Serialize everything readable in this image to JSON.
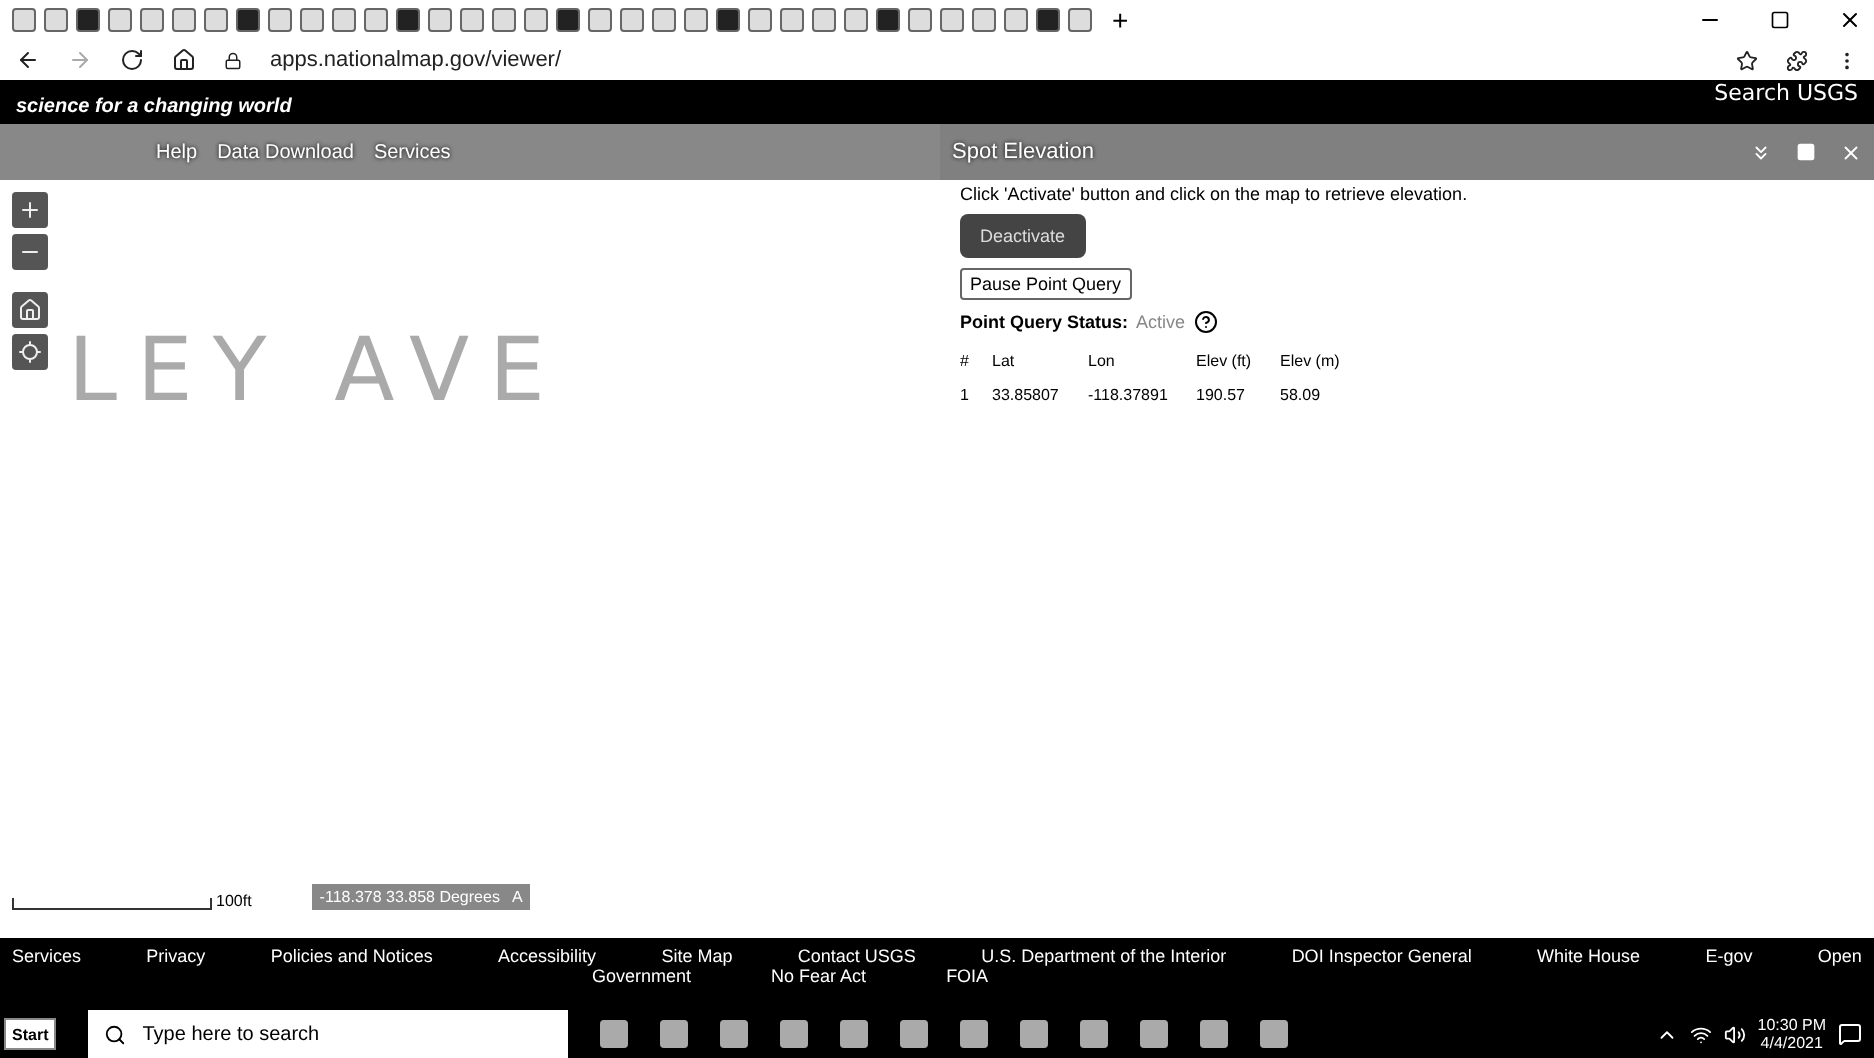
{
  "browser": {
    "url": "apps.nationalmap.gov/viewer/",
    "new_tab": "+"
  },
  "header": {
    "tagline": "science for a changing world",
    "search": "Search USGS"
  },
  "nav": [
    "Help",
    "Data Download",
    "Services"
  ],
  "map": {
    "street_label": "LEY AVE",
    "scale": "100ft",
    "coordinates": "-118.378 33.858 Degrees",
    "coord_toggle": "A"
  },
  "panel": {
    "title": "Spot Elevation",
    "instruction": "Click 'Activate' button and click on the map to retrieve elevation.",
    "activate_button": "Deactivate",
    "pause_button": "Pause Point Query",
    "status_label": "Point Query Status:",
    "status_value": "Active",
    "columns": [
      "#",
      "Lat",
      "Lon",
      "Elev (ft)",
      "Elev (m)"
    ],
    "rows": [
      [
        "1",
        "33.85807",
        "-118.37891",
        "190.57",
        "58.09"
      ]
    ]
  },
  "footer": {
    "links": [
      "Services",
      "Privacy",
      "Policies and Notices",
      "Accessibility",
      "Site Map",
      "Contact USGS",
      "U.S. Department of the Interior",
      "DOI Inspector General",
      "White House",
      "E-gov",
      "Open"
    ],
    "second_row": [
      "Government",
      "No Fear Act",
      "FOIA"
    ]
  },
  "taskbar": {
    "start": "Start",
    "search_placeholder": "Type here to search",
    "time": "10:30 PM",
    "date": "4/4/2021"
  }
}
